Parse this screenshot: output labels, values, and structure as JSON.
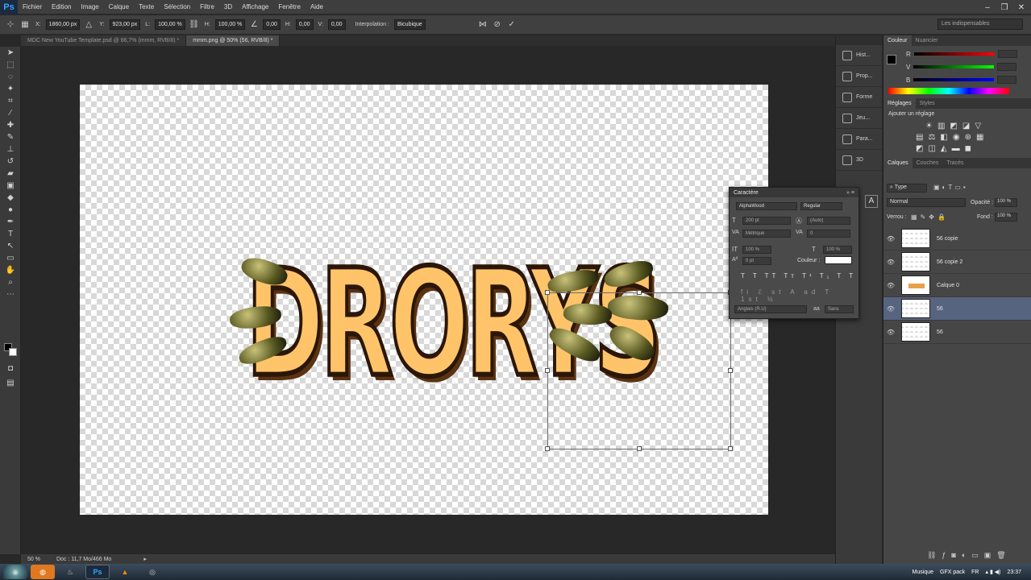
{
  "app": {
    "name": "Photoshop",
    "logo": "Ps",
    "accent": "#31a8ff"
  },
  "menu": [
    "Fichier",
    "Edition",
    "Image",
    "Calque",
    "Texte",
    "Sélection",
    "Filtre",
    "3D",
    "Affichage",
    "Fenêtre",
    "Aide"
  ],
  "options": {
    "x_label": "X:",
    "x_value": "1860,00 px",
    "y_label": "Y:",
    "y_value": "923,00 px",
    "w_label": "L:",
    "w_value": "100,00 %",
    "h_label": "H:",
    "h_value": "100,00 %",
    "angle_value": "0,00",
    "hskew_label": "H:",
    "hskew_value": "0,00",
    "vskew_label": "V:",
    "vskew_value": "0,00",
    "interp_label": "Interpolation :",
    "interp_value": "Bicubique",
    "workspace": "Les indispensables"
  },
  "tabs": [
    {
      "label": "MDC New YouTube Template.psd @ 66,7% (mmm, RVB/8) *",
      "active": false
    },
    {
      "label": "mmm.png @ 50% (56, RVB/8) *",
      "active": true
    }
  ],
  "canvas": {
    "text": "DRORYS"
  },
  "status": {
    "zoom": "50 %",
    "doc": "Doc : 11,7 Mo/466 Mo"
  },
  "collapsed_panels": [
    "Hist...",
    "Prop...",
    "Forme",
    "Jeu...",
    "Para...",
    "3D"
  ],
  "color_panel": {
    "tab1": "Couleur",
    "tab2": "Nuancier",
    "r": "R",
    "g": "V",
    "b": "B"
  },
  "adjust_panel": {
    "tab1": "Réglages",
    "tab2": "Styles",
    "title": "Ajouter un réglage"
  },
  "layers_panel": {
    "tabs": [
      "Calques",
      "Couches",
      "Tracés"
    ],
    "filter": "Type",
    "blend": "Normal",
    "opacity_label": "Opacité :",
    "opacity_value": "100 %",
    "lock_label": "Verrou :",
    "fill_label": "Fond :",
    "fill_value": "100 %",
    "layers": [
      {
        "name": "56 copie",
        "selected": false
      },
      {
        "name": "56 copie 2",
        "selected": false
      },
      {
        "name": "Calque 0",
        "selected": false
      },
      {
        "name": "56",
        "selected": true
      },
      {
        "name": "56",
        "selected": false
      }
    ]
  },
  "char_panel": {
    "title": "Caractère",
    "font": "AlphaWood",
    "style": "Regular",
    "size": "200 pt",
    "leading": "(Auto)",
    "kerning": "Métrique",
    "tracking": "0",
    "vscale": "100 %",
    "hscale": "100 %",
    "baseline": "0 pt",
    "color_label": "Couleur :",
    "language": "Anglais (R.U)",
    "aa_label": "aa",
    "aa_value": "Sans"
  },
  "taskbar": {
    "music": "Musique",
    "gfx": "GFX pack",
    "lang": "FR",
    "time": "23:37"
  }
}
